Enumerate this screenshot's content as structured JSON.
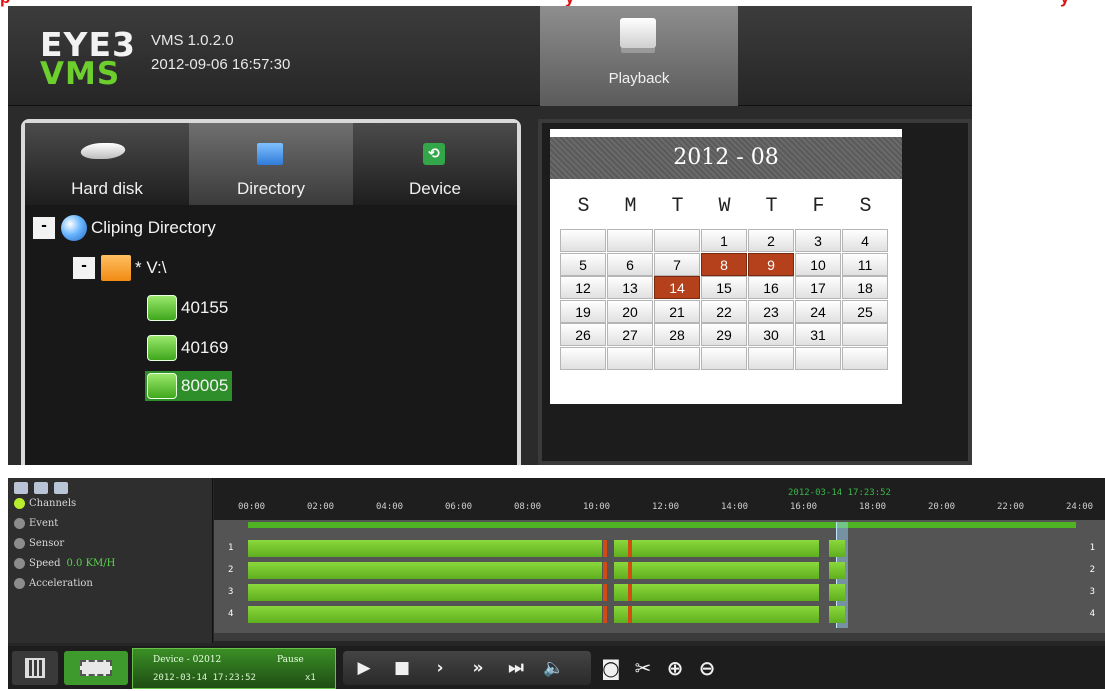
{
  "header": {
    "logo_top": "EYE3",
    "logo_bottom": "VMS",
    "version": "VMS 1.0.2.0",
    "datetime": "2012-09-06 16:57:30",
    "playback_label": "Playback"
  },
  "tabs": [
    {
      "label": "Hard disk",
      "icon": "hard-disk-icon"
    },
    {
      "label": "Directory",
      "icon": "folder-icon"
    },
    {
      "label": "Device",
      "icon": "device-icon"
    }
  ],
  "tree": {
    "root_label": "Cliping Directory",
    "expander_glyph": "-",
    "drive_label": "* V:\\",
    "devices": [
      "40155",
      "40169",
      "80005"
    ],
    "selected_device": "80005"
  },
  "calendar": {
    "month_label": "2012 - 08",
    "weekdays": [
      "S",
      "M",
      "T",
      "W",
      "T",
      "F",
      "S"
    ],
    "rows": [
      [
        "",
        "",
        "",
        "1",
        "2",
        "3",
        "4"
      ],
      [
        "5",
        "6",
        "7",
        "8",
        "9",
        "10",
        "11"
      ],
      [
        "12",
        "13",
        "14",
        "15",
        "16",
        "17",
        "18"
      ],
      [
        "19",
        "20",
        "21",
        "22",
        "23",
        "24",
        "25"
      ],
      [
        "26",
        "27",
        "28",
        "29",
        "30",
        "31",
        ""
      ],
      [
        "",
        "",
        "",
        "",
        "",
        "",
        ""
      ]
    ],
    "marked_days": [
      "8",
      "9",
      "14"
    ],
    "marked_color": "#b4401c"
  },
  "legend": {
    "items": [
      "Channels",
      "Event",
      "Sensor",
      "Speed",
      "Acceleration"
    ],
    "speed_value": "0.0 KM/H",
    "active_item": "Channels"
  },
  "timeline": {
    "hour_labels": [
      "00:00",
      "02:00",
      "04:00",
      "06:00",
      "08:00",
      "10:00",
      "12:00",
      "14:00",
      "16:00",
      "18:00",
      "20:00",
      "22:00",
      "24:00"
    ],
    "cursor_time": "2012-03-14 17:23:52",
    "channels": [
      "1",
      "2",
      "3",
      "4"
    ],
    "recording_color": "#6cc02a"
  },
  "player": {
    "device_label": "Device - 02012",
    "state": "Pause",
    "time": "2012-03-14 17:23:52",
    "speed": "x1",
    "buttons": [
      "play",
      "stop",
      "next-frame",
      "fast-forward",
      "skip-end",
      "volume"
    ],
    "tools": [
      "snapshot",
      "clip",
      "zoom-in",
      "zoom-out"
    ]
  }
}
